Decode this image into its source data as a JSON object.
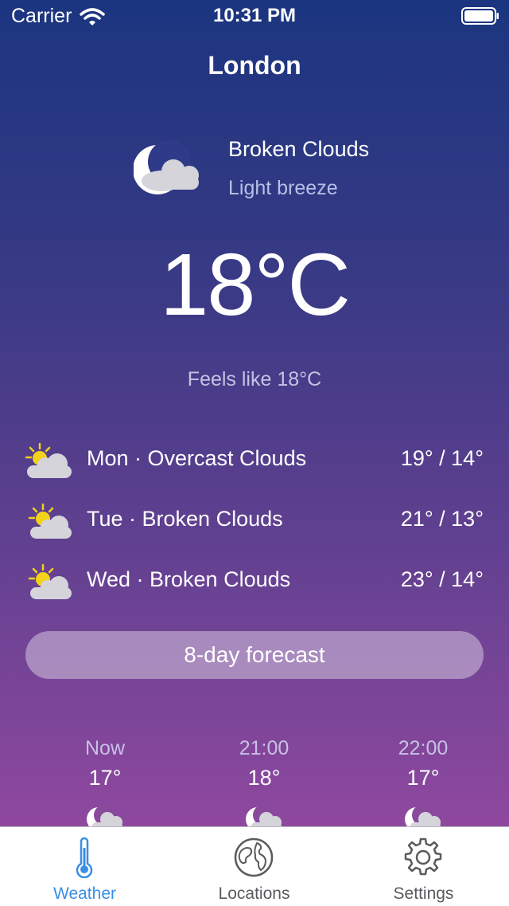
{
  "status_bar": {
    "carrier": "Carrier",
    "time": "10:31 PM"
  },
  "header": {
    "city": "London"
  },
  "current": {
    "icon": "moon-cloud-icon",
    "condition": "Broken Clouds",
    "wind": "Light breeze",
    "temperature": "18°C",
    "feels_like": "Feels like 18°C"
  },
  "daily": [
    {
      "icon": "sun-cloud-icon",
      "label": "Mon · Overcast Clouds",
      "temps": "19° / 14°"
    },
    {
      "icon": "sun-cloud-icon",
      "label": "Tue · Broken Clouds",
      "temps": "21° / 13°"
    },
    {
      "icon": "sun-cloud-icon",
      "label": "Wed · Broken Clouds",
      "temps": "23° / 14°"
    }
  ],
  "forecast_button": {
    "label": "8-day forecast"
  },
  "hourly": [
    {
      "time": "Now",
      "temp": "17°",
      "icon": "moon-cloud-icon"
    },
    {
      "time": "21:00",
      "temp": "18°",
      "icon": "moon-cloud-icon"
    },
    {
      "time": "22:00",
      "temp": "17°",
      "icon": "moon-cloud-icon"
    }
  ],
  "tabs": [
    {
      "label": "Weather",
      "icon": "thermometer-icon",
      "active": true
    },
    {
      "label": "Locations",
      "icon": "globe-icon",
      "active": false
    },
    {
      "label": "Settings",
      "icon": "gear-icon",
      "active": false
    }
  ],
  "colors": {
    "accent": "#3a8ee6",
    "tab_inactive": "#5a5a5f",
    "gradient_top": "#1b3580",
    "gradient_bottom": "#9a4aa2"
  }
}
